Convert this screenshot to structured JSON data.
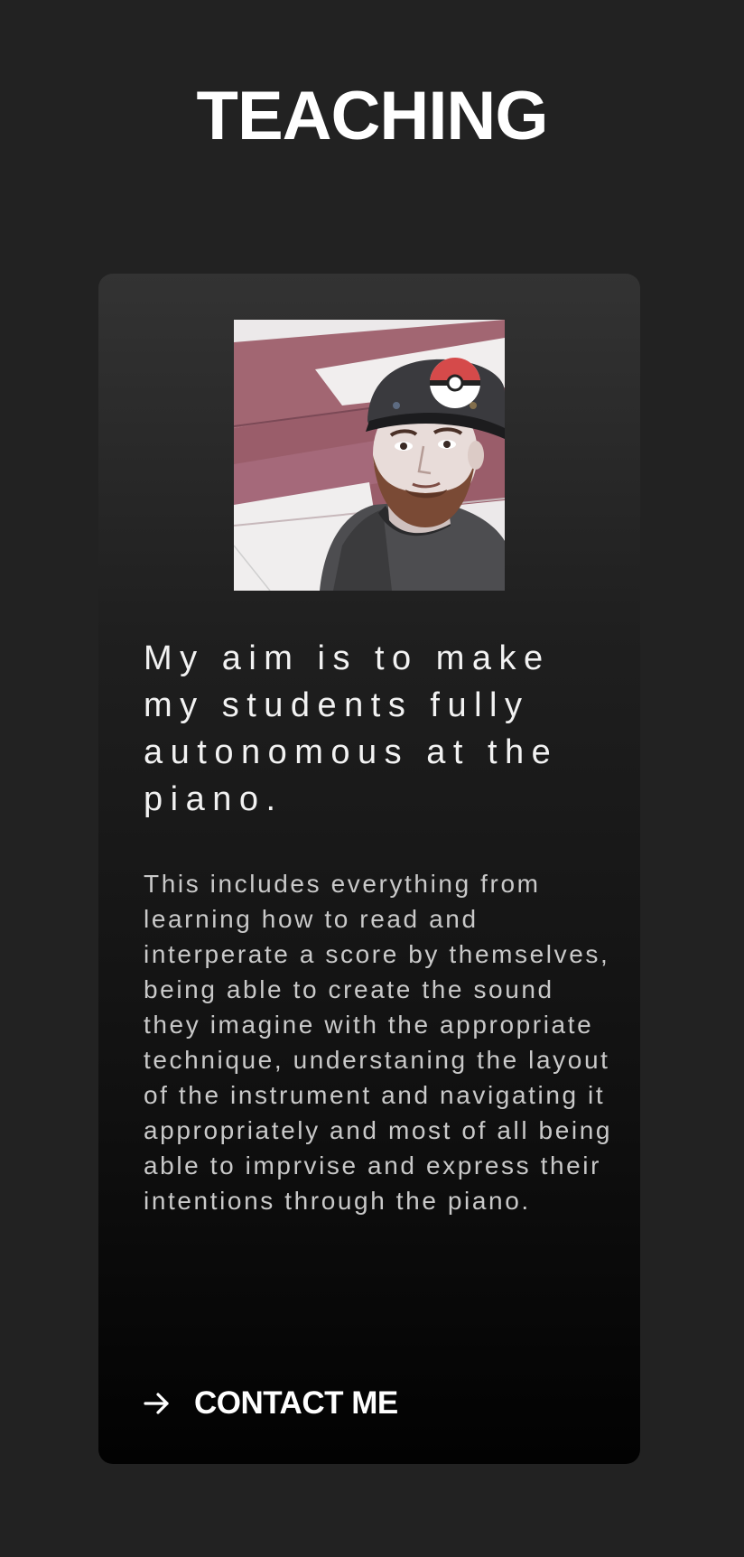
{
  "page": {
    "title": "TEACHING"
  },
  "card": {
    "headline": "My aim is to make my students fully autonomous at the piano.",
    "body": "This includes everything from learning how to read and interperate a score by themselves, being able to create the sound they imagine with the appropriate technique, understaning the layout of the instrument and navigating it appropriately and most of all being able to imprvise and express their intentions through the piano.",
    "contact_label": "CONTACT ME",
    "contact_icon": "arrow-right-icon"
  },
  "colors": {
    "background": "#222222",
    "card_top": "#333333",
    "card_bottom": "#020202",
    "text": "#ffffff",
    "body_text": "#c9c9c9"
  }
}
